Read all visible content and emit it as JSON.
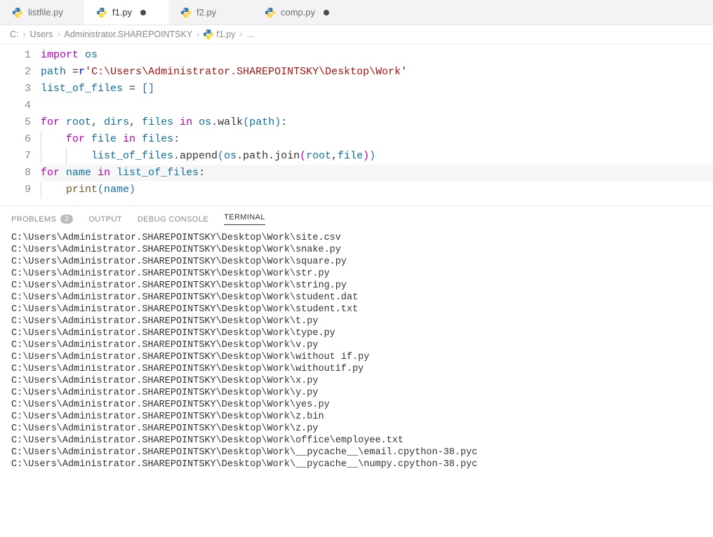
{
  "tabs": [
    {
      "label": "listfile.py",
      "active": false,
      "dirty": false
    },
    {
      "label": "f1.py",
      "active": true,
      "dirty": true
    },
    {
      "label": "f2.py",
      "active": false,
      "dirty": false
    },
    {
      "label": "comp.py",
      "active": false,
      "dirty": true
    }
  ],
  "breadcrumb": {
    "parts": [
      "C:",
      "Users",
      "Administrator.SHAREPOINTSKY"
    ],
    "file": "f1.py",
    "trail": "..."
  },
  "code": {
    "lines": [
      {
        "n": 1,
        "tokens": [
          [
            "kw2",
            "import"
          ],
          [
            "",
            " "
          ],
          [
            "var",
            "os"
          ]
        ]
      },
      {
        "n": 2,
        "tokens": [
          [
            "var",
            "path"
          ],
          [
            "",
            " "
          ],
          [
            "",
            "="
          ],
          [
            "kw",
            "r"
          ],
          [
            "str",
            "'C:\\Users\\Administrator.SHAREPOINTSKY\\Desktop\\Work'"
          ]
        ]
      },
      {
        "n": 3,
        "tokens": [
          [
            "var",
            "list_of_files"
          ],
          [
            "",
            " = "
          ],
          [
            "bracket1",
            "["
          ],
          [
            "bracket1",
            "]"
          ]
        ]
      },
      {
        "n": 4,
        "tokens": []
      },
      {
        "n": 5,
        "tokens": [
          [
            "kw2",
            "for"
          ],
          [
            "",
            " "
          ],
          [
            "var",
            "root"
          ],
          [
            "",
            ", "
          ],
          [
            "var",
            "dirs"
          ],
          [
            "",
            ", "
          ],
          [
            "var",
            "files"
          ],
          [
            "",
            " "
          ],
          [
            "kw2",
            "in"
          ],
          [
            "",
            " "
          ],
          [
            "var",
            "os"
          ],
          [
            "",
            ".walk"
          ],
          [
            "bracket1",
            "("
          ],
          [
            "var",
            "path"
          ],
          [
            "bracket1",
            ")"
          ],
          [
            "",
            ":"
          ]
        ]
      },
      {
        "n": 6,
        "indent": 1,
        "tokens": [
          [
            "kw2",
            "for"
          ],
          [
            "",
            " "
          ],
          [
            "var",
            "file"
          ],
          [
            "",
            " "
          ],
          [
            "kw2",
            "in"
          ],
          [
            "",
            " "
          ],
          [
            "var",
            "files"
          ],
          [
            "",
            ":"
          ]
        ]
      },
      {
        "n": 7,
        "indent": 2,
        "tokens": [
          [
            "var",
            "list_of_files"
          ],
          [
            "",
            ".append"
          ],
          [
            "bracket1",
            "("
          ],
          [
            "var",
            "os"
          ],
          [
            "",
            ".path.join"
          ],
          [
            "bracket2",
            "("
          ],
          [
            "var",
            "root"
          ],
          [
            "",
            ","
          ],
          [
            "var",
            "file"
          ],
          [
            "bracket2",
            ")"
          ],
          [
            "bracket1",
            ")"
          ]
        ]
      },
      {
        "n": 8,
        "hl": true,
        "tokens": [
          [
            "kw2",
            "for"
          ],
          [
            "",
            " "
          ],
          [
            "var",
            "name"
          ],
          [
            "",
            " "
          ],
          [
            "kw2",
            "in"
          ],
          [
            "",
            " "
          ],
          [
            "var",
            "list_of_files"
          ],
          [
            "",
            ":"
          ]
        ]
      },
      {
        "n": 9,
        "indent": 1,
        "tokens": [
          [
            "fn",
            "print"
          ],
          [
            "bracket1",
            "("
          ],
          [
            "var",
            "name"
          ],
          [
            "bracket1",
            ")"
          ]
        ]
      }
    ]
  },
  "panel": {
    "tabs": {
      "problems": "PROBLEMS",
      "problems_count": "2",
      "output": "OUTPUT",
      "debug": "DEBUG CONSOLE",
      "terminal": "TERMINAL"
    },
    "terminal_lines": [
      "C:\\Users\\Administrator.SHAREPOINTSKY\\Desktop\\Work\\site.csv",
      "C:\\Users\\Administrator.SHAREPOINTSKY\\Desktop\\Work\\snake.py",
      "C:\\Users\\Administrator.SHAREPOINTSKY\\Desktop\\Work\\square.py",
      "C:\\Users\\Administrator.SHAREPOINTSKY\\Desktop\\Work\\str.py",
      "C:\\Users\\Administrator.SHAREPOINTSKY\\Desktop\\Work\\string.py",
      "C:\\Users\\Administrator.SHAREPOINTSKY\\Desktop\\Work\\student.dat",
      "C:\\Users\\Administrator.SHAREPOINTSKY\\Desktop\\Work\\student.txt",
      "C:\\Users\\Administrator.SHAREPOINTSKY\\Desktop\\Work\\t.py",
      "C:\\Users\\Administrator.SHAREPOINTSKY\\Desktop\\Work\\type.py",
      "C:\\Users\\Administrator.SHAREPOINTSKY\\Desktop\\Work\\v.py",
      "C:\\Users\\Administrator.SHAREPOINTSKY\\Desktop\\Work\\without if.py",
      "C:\\Users\\Administrator.SHAREPOINTSKY\\Desktop\\Work\\withoutif.py",
      "C:\\Users\\Administrator.SHAREPOINTSKY\\Desktop\\Work\\x.py",
      "C:\\Users\\Administrator.SHAREPOINTSKY\\Desktop\\Work\\y.py",
      "C:\\Users\\Administrator.SHAREPOINTSKY\\Desktop\\Work\\yes.py",
      "C:\\Users\\Administrator.SHAREPOINTSKY\\Desktop\\Work\\z.bin",
      "C:\\Users\\Administrator.SHAREPOINTSKY\\Desktop\\Work\\z.py",
      "C:\\Users\\Administrator.SHAREPOINTSKY\\Desktop\\Work\\office\\employee.txt",
      "C:\\Users\\Administrator.SHAREPOINTSKY\\Desktop\\Work\\__pycache__\\email.cpython-38.pyc",
      "C:\\Users\\Administrator.SHAREPOINTSKY\\Desktop\\Work\\__pycache__\\numpy.cpython-38.pyc"
    ]
  }
}
